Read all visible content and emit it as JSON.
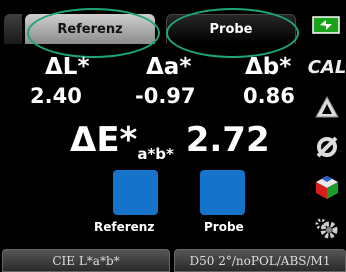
{
  "tabs": {
    "reference": "Referenz",
    "sample": "Probe"
  },
  "measurement": {
    "dL_label": "ΔL*",
    "da_label": "Δa*",
    "db_label": "Δb*",
    "dL": "2.40",
    "da": "-0.97",
    "db": "0.86",
    "dE_label": "ΔE*",
    "dE_sub": "a*b*",
    "dE": "2.72"
  },
  "swatches": {
    "reference_label": "Referenz",
    "sample_label": "Probe",
    "reference_color": "#1573c9",
    "sample_color": "#1573c9"
  },
  "sidebar": {
    "cal_label": "CAL",
    "icons": [
      "battery-plug-icon",
      "cal-icon",
      "delta-icon",
      "sigma-icon",
      "color-cube-icon",
      "gear-icon"
    ]
  },
  "footer": {
    "color_space": "CIE L*a*b*",
    "conditions": "D50 2°/noPOL/ABS/M1"
  },
  "colors": {
    "highlight_oval": "#1ea57a",
    "swatch": "#1573c9"
  }
}
